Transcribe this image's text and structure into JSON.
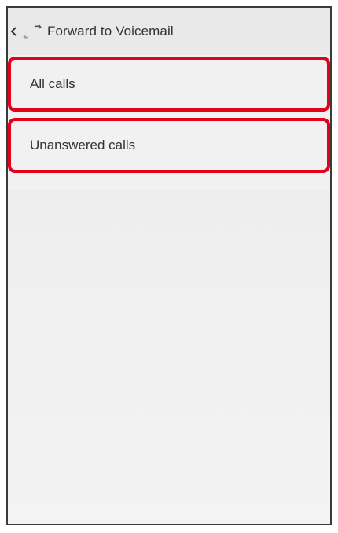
{
  "header": {
    "title": "Forward to Voicemail",
    "back_icon": "chevron-left-icon",
    "app_icon": "phone-forward-icon"
  },
  "options": [
    {
      "label": "All calls"
    },
    {
      "label": "Unanswered calls"
    }
  ],
  "colors": {
    "highlight": "#e2001a",
    "background": "#f1f1f1",
    "text": "#333333"
  }
}
